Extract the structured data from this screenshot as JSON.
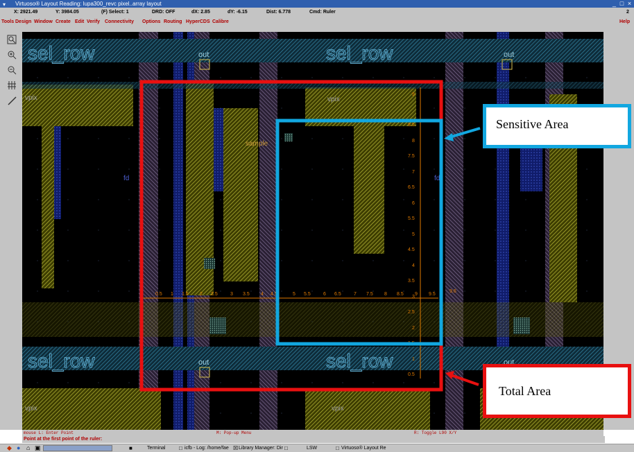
{
  "window": {
    "title": "Virtuoso® Layout Reading: lupa300_revc pixel..array layout",
    "buttons": {
      "minimize": "_",
      "maximize": "□",
      "close": "×"
    }
  },
  "status": {
    "x": "X: 2921.49",
    "y": "Y: 3984.05",
    "select": "(F) Select: 1",
    "drd": "DRD: OFF",
    "dx": "dX: 2.85",
    "dy": "dY: -6.15",
    "dist": "Dist: 6.778",
    "cmd": "Cmd: Ruler",
    "right": "2"
  },
  "menu": {
    "items": [
      "Tools",
      "Design",
      "Window",
      "Create",
      "Edit",
      "Verify",
      "Connectivity",
      "Options",
      "Routing",
      "HyperCDS",
      "Calibre"
    ],
    "help": "Help"
  },
  "toolbar": [
    "zoom-fit-icon",
    "zoom-in-icon",
    "zoom-out-icon",
    "grid-icon",
    "ruler-icon"
  ],
  "layout": {
    "labels": {
      "sel_row": "sel_row",
      "out": "out",
      "vpix": "vpix",
      "sample": "sample",
      "fd": "fd"
    },
    "ruler_vertical": [
      "9",
      "8.5",
      "8",
      "7.5",
      "7",
      "6.5",
      "6",
      "5.5",
      "5",
      "4.5",
      "4",
      "3.5",
      "3",
      "2.5",
      "2",
      "1.5",
      "1",
      "0.5"
    ],
    "ruler_horizontal": [
      "0.5",
      "1",
      "1.5",
      "2",
      "2.5",
      "3",
      "3.5",
      "4",
      "4.5",
      "5",
      "5.5",
      "6",
      "6.5",
      "7",
      "7.5",
      "8",
      "8.5",
      "9",
      "9.5"
    ],
    "ruler_end_label": "9.6"
  },
  "annotations": {
    "sensitive": "Sensitive Area",
    "total": "Total Area"
  },
  "prompts": {
    "left": "mouse L: Enter Point",
    "middle": "M: Pop-up Menu",
    "right": "R: Toggle L90 X/Y",
    "line2": "Point at the first point of the ruler:"
  },
  "taskbar": {
    "items": [
      "Terminal",
      "icfb - Log: /home/fae",
      "Library Manager: Dir",
      "LSW",
      "Virtuoso® Layout Re"
    ]
  },
  "colors": {
    "canvas": "#000000",
    "sensitive_box": "#12a7e0",
    "total_box": "#e81010",
    "ruler": "#e07a00",
    "menu_text": "#b00000",
    "title_bg": "#2f5fae"
  }
}
